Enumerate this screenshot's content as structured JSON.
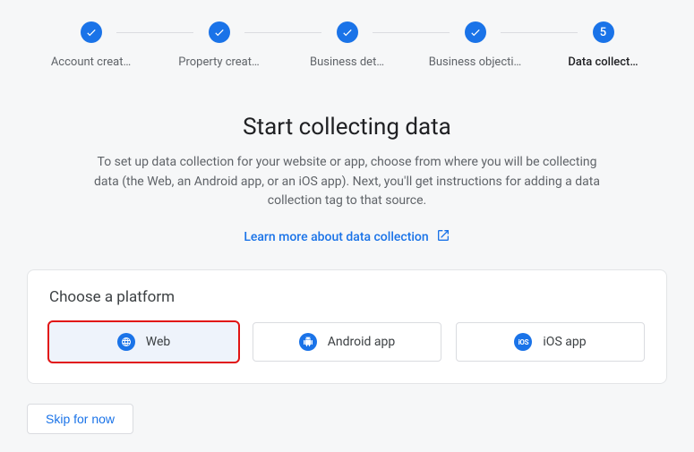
{
  "stepper": {
    "steps": [
      {
        "label": "Account creat…",
        "completed": true
      },
      {
        "label": "Property creat…",
        "completed": true
      },
      {
        "label": "Business det…",
        "completed": true
      },
      {
        "label": "Business objecti…",
        "completed": true
      },
      {
        "label": "Data collect…",
        "completed": false,
        "number": "5",
        "active": true
      }
    ]
  },
  "heading": {
    "title": "Start collecting data",
    "description": "To set up data collection for your website or app, choose from where you will be collecting data (the Web, an Android app, or an iOS app). Next, you'll get instructions for adding a data collection tag to that source.",
    "learn_more": "Learn more about data collection"
  },
  "card": {
    "title": "Choose a platform",
    "platforms": [
      {
        "label": "Web",
        "icon": "web-icon",
        "selected": true
      },
      {
        "label": "Android app",
        "icon": "android-icon",
        "selected": false
      },
      {
        "label": "iOS app",
        "icon": "ios-icon",
        "selected": false
      }
    ]
  },
  "actions": {
    "skip": "Skip for now"
  },
  "colors": {
    "primary": "#1a73e8",
    "highlight_border": "#e11414"
  }
}
